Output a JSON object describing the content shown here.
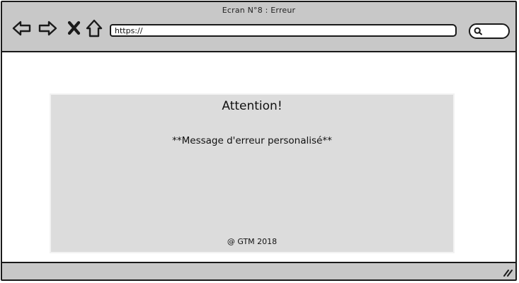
{
  "window": {
    "title": "Ecran N°8 : Erreur"
  },
  "toolbar": {
    "back_icon": "arrow-left-icon",
    "forward_icon": "arrow-right-icon",
    "stop_icon": "close-icon",
    "home_icon": "home-icon",
    "url_value": "https://",
    "search_icon": "search-icon"
  },
  "panel": {
    "heading": "Attention!",
    "message": "**Message d'erreur personalisé**",
    "footer": "@ GTM 2018"
  },
  "colors": {
    "chrome": "#c8c8c8",
    "panel": "#dcdcdc",
    "stroke": "#1a1a1a"
  }
}
